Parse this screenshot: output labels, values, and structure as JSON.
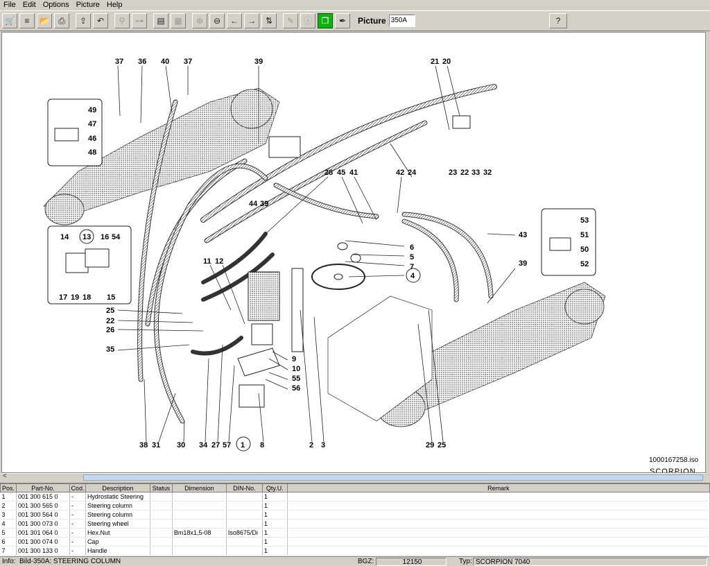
{
  "menu": [
    "File",
    "Edit",
    "Options",
    "Picture",
    "Help"
  ],
  "toolbar": {
    "picture_label": "Picture",
    "picture_value": "350A",
    "help_glyph": "?"
  },
  "drawing": {
    "iso_label": "1000167258.iso",
    "scorpion_label": "SCORPION",
    "callouts": [
      "37",
      "36",
      "40",
      "37",
      "39",
      "21",
      "20",
      "49",
      "47",
      "46",
      "48",
      "28",
      "45",
      "41",
      "42",
      "24",
      "23",
      "22",
      "33",
      "32",
      "44",
      "39",
      "14",
      "13",
      "16",
      "54",
      "15",
      "17",
      "19",
      "18",
      "53",
      "51",
      "50",
      "52",
      "43",
      "39",
      "6",
      "5",
      "7",
      "4",
      "11",
      "12",
      "25",
      "22",
      "26",
      "35",
      "9",
      "10",
      "55",
      "56",
      "38",
      "31",
      "30",
      "34",
      "27",
      "57",
      "1",
      "8",
      "2",
      "3",
      "29",
      "25"
    ]
  },
  "table": {
    "headers": [
      "Pos.",
      "Part-No.",
      "Cod.",
      "Description",
      "Status",
      "Dimension",
      "DIN-No.",
      "Qty.U.",
      "Remark"
    ],
    "rows": [
      [
        "1",
        "001 300 615 0",
        "-",
        "Hydrostatic Steering",
        "",
        "",
        "",
        "1",
        ""
      ],
      [
        "2",
        "001 300 565 0",
        "-",
        "Steering column",
        "",
        "",
        "",
        "1",
        ""
      ],
      [
        "3",
        "001 300 564 0",
        "-",
        "Steering column",
        "",
        "",
        "",
        "1",
        ""
      ],
      [
        "4",
        "001 300 073 0",
        "-",
        "Steering wheel",
        "",
        "",
        "",
        "1",
        ""
      ],
      [
        "5",
        "001 301 064 0",
        "-",
        "Hex.Nut",
        "",
        "Bm18x1,5-08",
        "Iso8675/Di",
        "1",
        ""
      ],
      [
        "6",
        "001 300 074 0",
        "-",
        "Cap",
        "",
        "",
        "",
        "1",
        ""
      ],
      [
        "7",
        "001 300 133 0",
        "-",
        "Handle",
        "",
        "",
        "",
        "1",
        ""
      ]
    ]
  },
  "status": {
    "info_label": "Info:",
    "info_value": "Bild-350A: STEERING COLUMN",
    "bgz_label": "BGZ:",
    "bgz_value": "12150",
    "typ_label": "Typ:",
    "typ_value": "SCORPION 7040"
  }
}
